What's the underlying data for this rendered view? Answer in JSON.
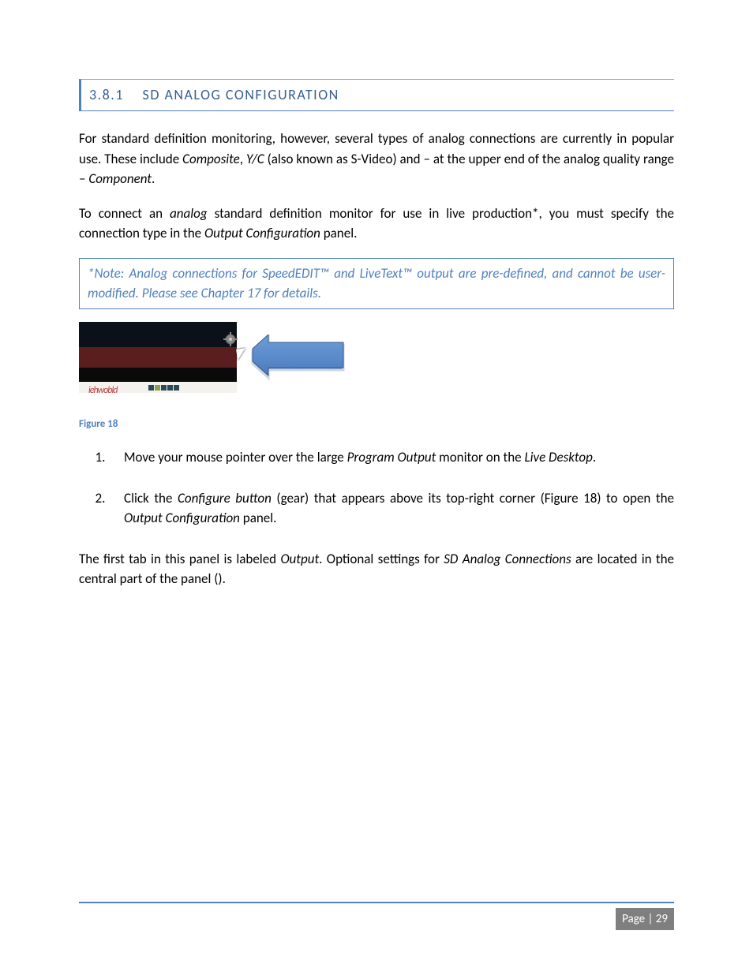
{
  "section": {
    "number": "3.8.1",
    "title": "SD ANALOG CONFIGURATION"
  },
  "paragraphs": {
    "p1_a": "For standard definition monitoring, however, several types of analog connections are currently in popular use.  These include ",
    "p1_composite": "Composite",
    "p1_b": ", ",
    "p1_yc": "Y/C",
    "p1_c": " (also known as S-Video) and – at the upper end of the analog quality range – ",
    "p1_component": "Component",
    "p1_d": ".",
    "p2_a": "To connect an ",
    "p2_analog": "analog",
    "p2_b": " standard definition monitor for use in live production*, you must specify the connection type in the ",
    "p2_outputconfig": "Output Configuration",
    "p2_c": " panel."
  },
  "note": "*Note: Analog connections for SpeedEDIT™ and LiveText™ output are pre-defined, and cannot be user-modified.  Please see Chapter 17 for details.",
  "figure_caption": "Figure 18",
  "list": {
    "i1_a": "Move your mouse pointer over the large ",
    "i1_prog": "Program Output",
    "i1_b": " monitor on the ",
    "i1_live": "Live Desktop",
    "i1_c": ".",
    "i2_a": "Click the ",
    "i2_conf": "Configure button",
    "i2_b": " (gear) that appears above its top-right corner (Figure 18) to open the ",
    "i2_out": "Output Configuration",
    "i2_c": " panel."
  },
  "closing": {
    "a": "The first tab in this panel is labeled ",
    "output": "Output",
    "b": ".   Optional settings for ",
    "sdanalog": "SD Analog Connections",
    "c": " are located in the central part of the panel ()."
  },
  "footer": {
    "page_label": "Page | 29"
  }
}
